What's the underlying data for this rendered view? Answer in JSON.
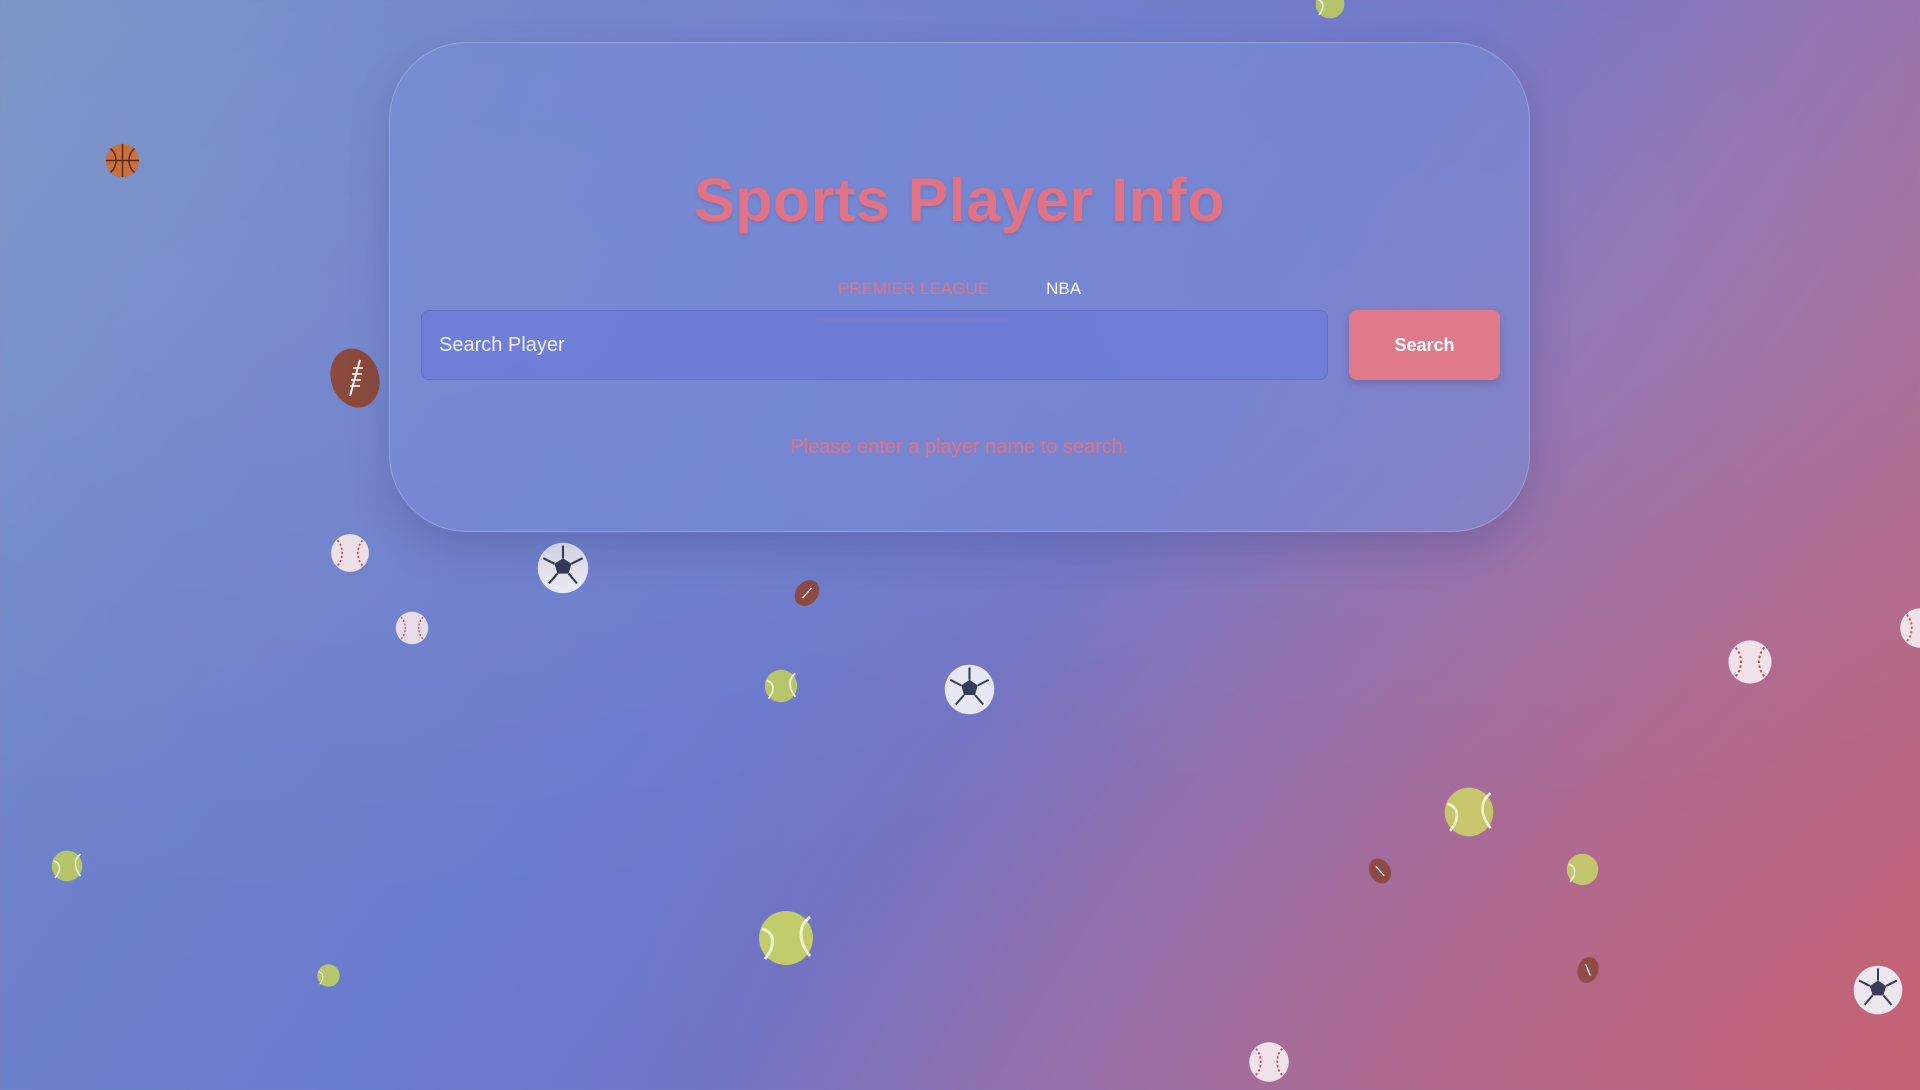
{
  "app": {
    "title": "Sports Player Info"
  },
  "tabs": [
    {
      "label": "PREMIER LEAGUE",
      "active": true
    },
    {
      "label": "NBA",
      "active": false
    }
  ],
  "search": {
    "placeholder": "Search Player",
    "value": "",
    "button_label": "Search"
  },
  "status": {
    "message": "Please enter a player name to search."
  },
  "colors": {
    "accent": "#e07386",
    "button": "#e07a8b",
    "card": "#788cd7",
    "background_start": "#7b95c6",
    "background_end": "#bf6477"
  },
  "decorations": {
    "balls": [
      "basketball",
      "american-football",
      "baseball",
      "soccer-ball",
      "tennis-ball"
    ]
  }
}
